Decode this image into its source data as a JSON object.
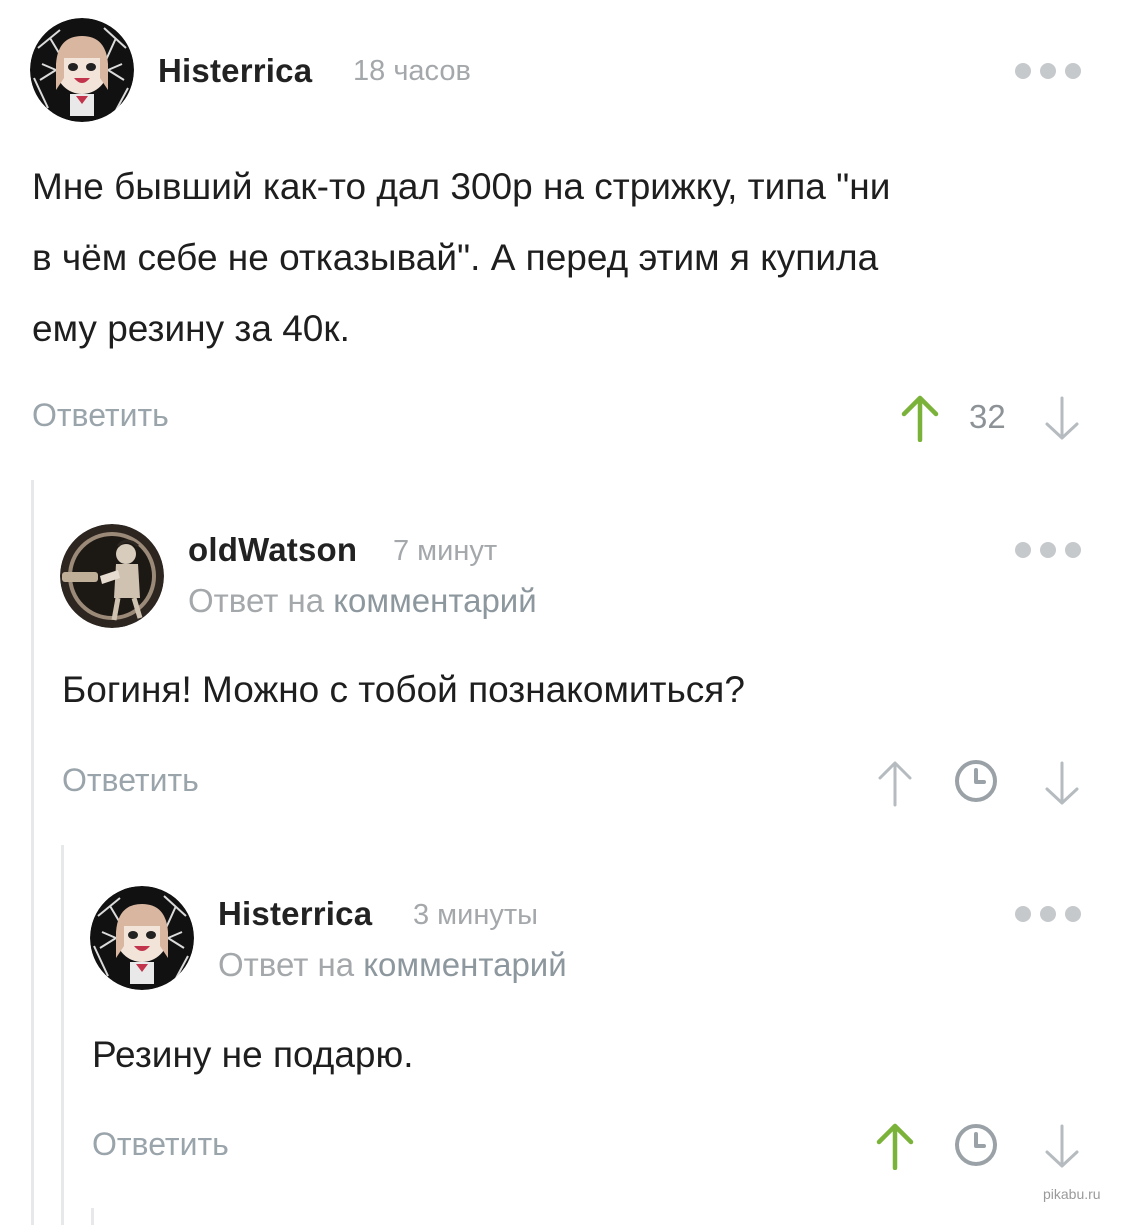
{
  "colors": {
    "upvote_active": "#7bb33a",
    "vote_inactive": "#b5bbbf",
    "muted_text": "#a4a8ab",
    "reply_link": "#9aa4ab"
  },
  "comments": [
    {
      "username": "Histerrica",
      "time": "18 часов",
      "text_lines": [
        "Мне бывший как-то дал 300р на стрижку, типа \"ни",
        "в чём себе не отказывай\". А перед этим я купила",
        "ему резину за 40к."
      ],
      "reply_label": "Ответить",
      "score": "32",
      "upvote_icon": "arrow-up-icon",
      "downvote_icon": "arrow-down-icon"
    },
    {
      "username": "oldWatson",
      "time": "7 минут",
      "reply_to_prefix": "Ответ на",
      "reply_to_link": "комментарий",
      "text_lines": [
        "Богиня! Можно с тобой познакомиться?"
      ],
      "reply_label": "Ответить",
      "pending_icon": "clock-icon"
    },
    {
      "username": "Histerrica",
      "time": "3 минуты",
      "reply_to_prefix": "Ответ на",
      "reply_to_link": "комментарий",
      "text_lines": [
        "Резину не подарю."
      ],
      "reply_label": "Ответить",
      "pending_icon": "clock-icon"
    }
  ],
  "watermark": "pikabu.ru"
}
